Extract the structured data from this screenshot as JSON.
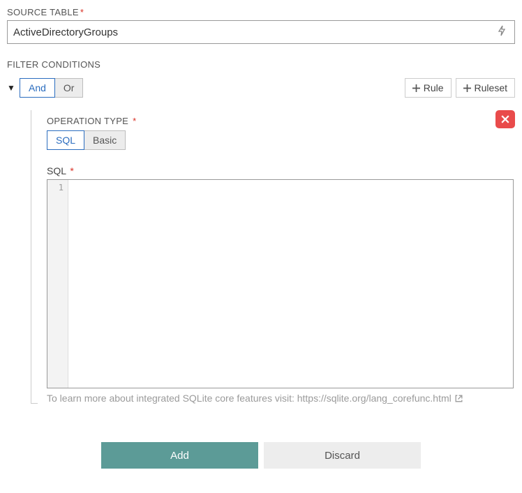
{
  "sourceTable": {
    "label": "SOURCE TABLE",
    "value": "ActiveDirectoryGroups"
  },
  "filter": {
    "title": "FILTER CONDITIONS",
    "logic": {
      "and": "And",
      "or": "Or"
    },
    "ruleBtn": "Rule",
    "rulesetBtn": "Ruleset"
  },
  "operation": {
    "label": "OPERATION TYPE",
    "sql": "SQL",
    "basic": "Basic"
  },
  "sql": {
    "label": "SQL",
    "lineNo": "1",
    "help": "To learn more about integrated SQLite core features visit: https://sqlite.org/lang_corefunc.html"
  },
  "footer": {
    "add": "Add",
    "discard": "Discard"
  },
  "asterisk": "*"
}
